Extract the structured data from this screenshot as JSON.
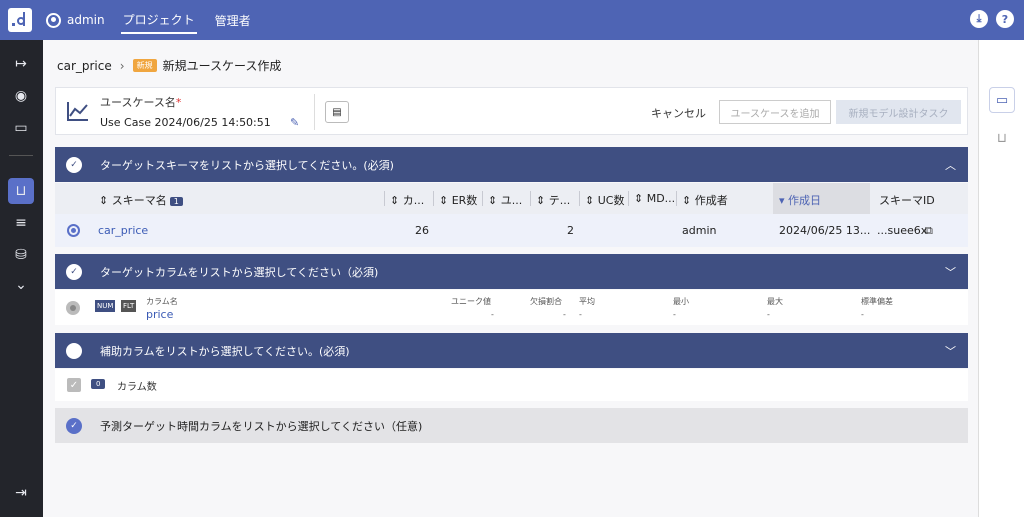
{
  "topbar": {
    "user": "admin",
    "nav": [
      "プロジェクト",
      "管理者"
    ],
    "right_icons": [
      "download-icon",
      "help-icon"
    ]
  },
  "breadcrumb": {
    "project": "car_price",
    "badge": "新規",
    "page": "新規ユースケース作成"
  },
  "usecase": {
    "label": "ユースケース名",
    "required": "*",
    "value": "Use Case 2024/06/25 14:50:51",
    "cancel": "キャンセル",
    "add_button": "ユースケースを追加",
    "task_button": "新規モデル設計タスク"
  },
  "sections": {
    "schema": "ターゲットスキーマをリストから選択してください。(必須)",
    "target": "ターゲットカラムをリストから選択してください（必須)",
    "aux": "補助カラムをリストから選択してください。(必須)",
    "time": "予測ターゲット時間カラムをリストから選択してください（任意)"
  },
  "schema_table": {
    "headers": {
      "name": "スキーマ名",
      "name_count": "1",
      "col": "カ...",
      "er": "ER数",
      "u": "ユ...",
      "te": "テ...",
      "uc": "UC数",
      "md": "MD...",
      "creator": "作成者",
      "created": "作成日",
      "schema_id": "スキーマID"
    },
    "rows": [
      {
        "name": "car_price",
        "col": "26",
        "te": "2",
        "creator": "admin",
        "created": "2024/06/25 13...",
        "schema_id": "...suee6x"
      }
    ]
  },
  "target_column": {
    "type1": "NUM",
    "type2": "FLT",
    "name_label": "カラム名",
    "name": "price",
    "stats": [
      {
        "label": "ユニーク値",
        "value": "-"
      },
      {
        "label": "欠損割合",
        "value": "-"
      },
      {
        "label": "平均",
        "value": "-"
      },
      {
        "label": "最小",
        "value": "-"
      },
      {
        "label": "最大",
        "value": "-"
      },
      {
        "label": "標準偏差",
        "value": "-"
      }
    ]
  },
  "aux_column": {
    "count": "0",
    "count_label": "カラム数"
  }
}
